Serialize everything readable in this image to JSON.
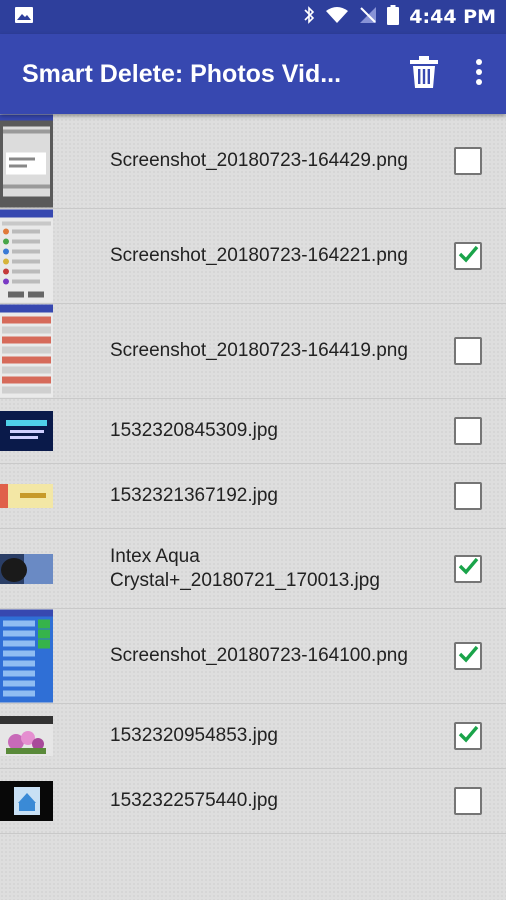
{
  "status_bar": {
    "time": "4:44 PM"
  },
  "app_bar": {
    "title": "Smart Delete: Photos Vid...",
    "delete_icon": "trash-icon",
    "menu_icon": "more-vert-icon"
  },
  "colors": {
    "status_bar": "#2e3f9c",
    "app_bar": "#3748b0",
    "check": "#1aa44a"
  },
  "files": [
    {
      "name": "Screenshot_20180723-164429.png",
      "checked": false,
      "thumb": "screenshot-thumb"
    },
    {
      "name": "Screenshot_20180723-164221.png",
      "checked": true,
      "thumb": "screenshot-thumb"
    },
    {
      "name": "Screenshot_20180723-164419.png",
      "checked": false,
      "thumb": "screenshot-thumb"
    },
    {
      "name": "1532320845309.jpg",
      "checked": false,
      "thumb": "image-thumb"
    },
    {
      "name": "1532321367192.jpg",
      "checked": false,
      "thumb": "image-thumb"
    },
    {
      "name": "Intex Aqua Crystal+_20180721_170013.jpg",
      "checked": true,
      "thumb": "image-thumb"
    },
    {
      "name": "Screenshot_20180723-164100.png",
      "checked": true,
      "thumb": "screenshot-thumb"
    },
    {
      "name": "1532320954853.jpg",
      "checked": true,
      "thumb": "image-thumb"
    },
    {
      "name": "1532322575440.jpg",
      "checked": false,
      "thumb": "image-thumb"
    }
  ]
}
